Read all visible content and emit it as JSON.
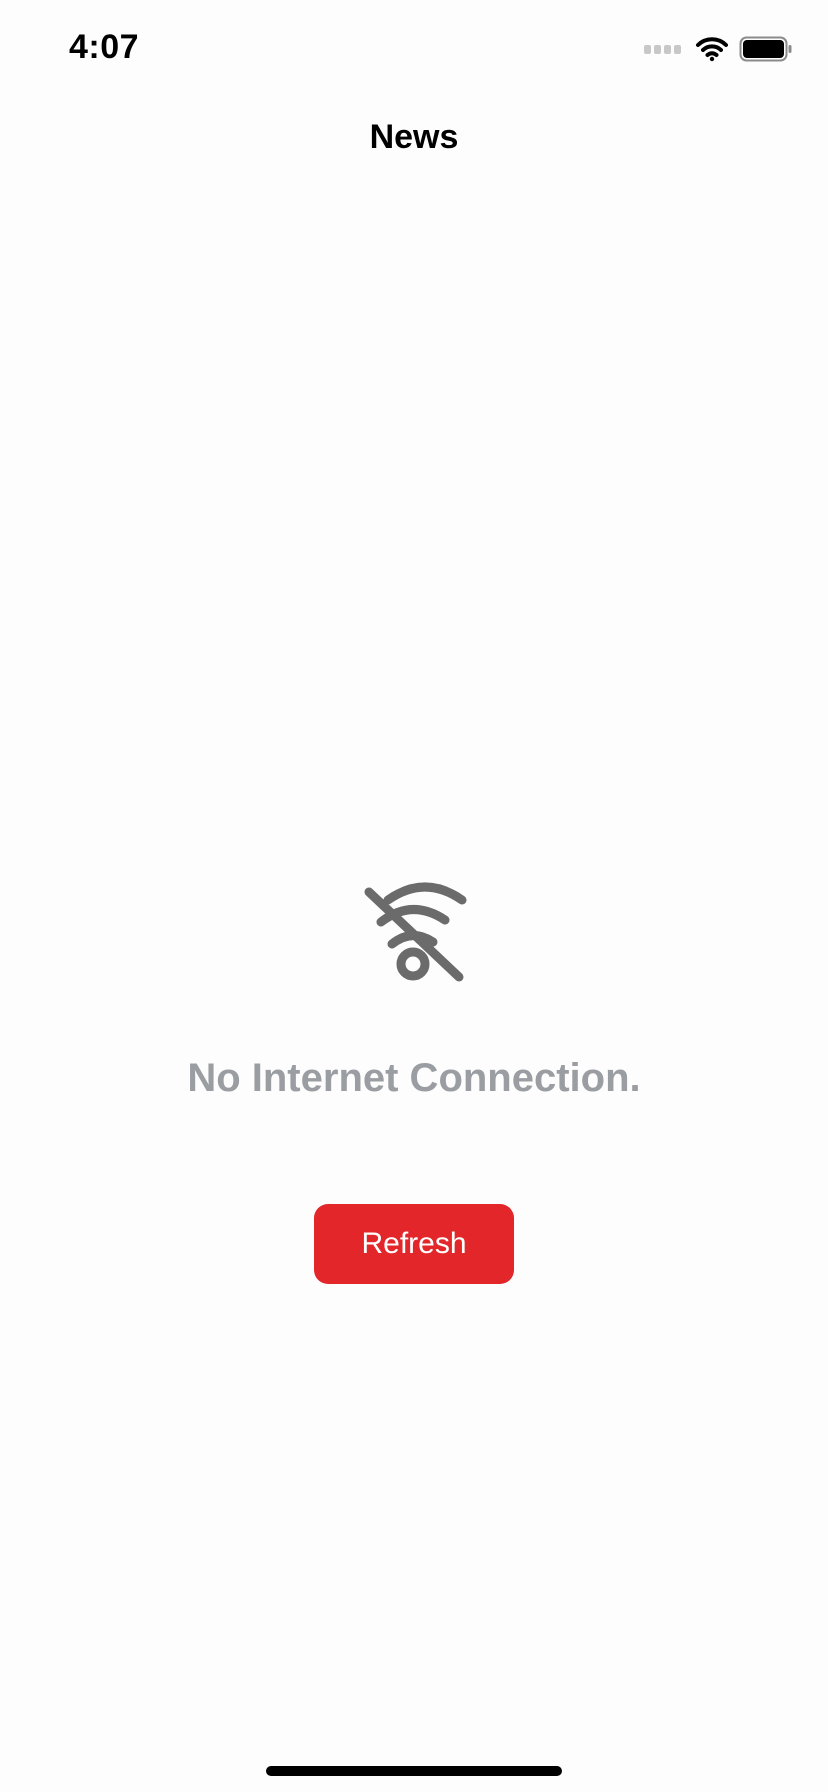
{
  "status_bar": {
    "time": "4:07",
    "signal_icon": "signal-bars-icon",
    "wifi_icon": "wifi-icon",
    "battery_icon": "battery-icon"
  },
  "navigation": {
    "title": "News"
  },
  "empty_state": {
    "icon": "wifi-off-icon",
    "message": "No Internet Connection.",
    "refresh_label": "Refresh"
  },
  "colors": {
    "accent": "#e3262a",
    "message_text": "#9a9da1",
    "icon_gray": "#6b6b6b",
    "background": "#fdfdfd"
  }
}
